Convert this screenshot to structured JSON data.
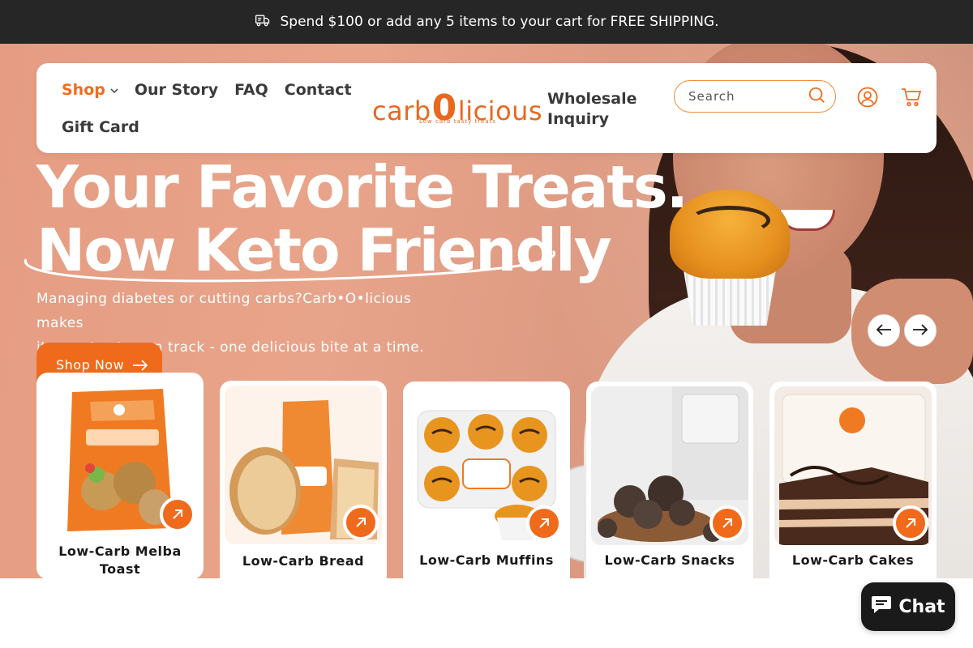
{
  "announcement": {
    "text": "Spend $100 or add any 5 items to your cart for FREE SHIPPING.",
    "icon": "truck-icon"
  },
  "nav": {
    "links_row1": [
      {
        "label": "Shop",
        "active": true,
        "dropdown": true
      },
      {
        "label": "Our Story"
      },
      {
        "label": "FAQ"
      },
      {
        "label": "Contact"
      }
    ],
    "links_row2": [
      {
        "label": "Gift Card"
      }
    ],
    "wholesale_label": "Wholesale Inquiry",
    "logo": {
      "wordmark_pre": "carb",
      "wordmark_zero": "0",
      "wordmark_post": "licious",
      "tagline": "Low carb tasty treats"
    },
    "search": {
      "placeholder": "Search",
      "value": ""
    },
    "account_icon": "account-icon",
    "cart_icon": "cart-icon"
  },
  "hero": {
    "headline_line1": "Your Favorite Treats.",
    "headline_line2": "Now Keto Friendly",
    "subcopy_line1": "Managing diabetes or cutting carbs?Carb•O•licious makes",
    "subcopy_line2": "it easy to stay on track - one delicious bite at a time.",
    "cta_label": "Shop Now"
  },
  "carousel": {
    "prev_icon": "arrow-left-icon",
    "next_icon": "arrow-right-icon"
  },
  "products": [
    {
      "label": "Low-Carb Melba Toast"
    },
    {
      "label": "Low-Carb Bread"
    },
    {
      "label": "Low-Carb Muffins"
    },
    {
      "label": "Low-Carb Snacks"
    },
    {
      "label": "Low-Carb Cakes"
    }
  ],
  "chat": {
    "label": "Chat",
    "icon": "chat-bubble-icon"
  },
  "colors": {
    "brand_orange": "#f06a1b",
    "announcement_bg": "#262626",
    "hero_peach": "#e59c82"
  }
}
